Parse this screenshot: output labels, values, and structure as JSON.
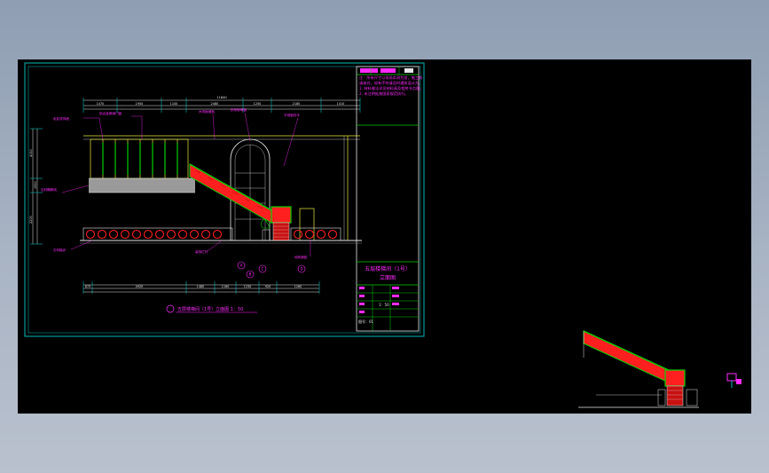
{
  "title_block": {
    "project_title": "五层楼梯间（1号）",
    "sheet_title": "立面图",
    "scale": "1：50",
    "sheet_no": "图号：01"
  },
  "notes": [
    "注：所有尺寸以现场实测为准，施工前",
    "请核对，如有不符请及时通知设计方。",
    "1. 材料做法详见材料表及相关节点图。",
    "2. 未注明处按国家规范执行。"
  ],
  "dimensions": {
    "top_total": "11840",
    "top_segments": [
      "1470",
      "1950",
      "1100",
      "2480",
      "1250",
      "2180",
      "1410"
    ],
    "bottom_total": "11840",
    "bottom_segments": [
      "870",
      "4920",
      "1480",
      "1160",
      "1230",
      "920",
      "1260"
    ],
    "left_heights": [
      "4150",
      "1950",
      "2200"
    ]
  },
  "callouts": [
    "乳胶漆饰面",
    "铝合金玻璃门窗",
    "木饰面墙板",
    "石材踢脚线",
    "拱形玻璃窗",
    "不锈钢扶手",
    "石材踏步",
    "装饰栏杆",
    "地砖铺贴"
  ],
  "detail_labels": [
    "A",
    "B",
    "C",
    "D"
  ],
  "drawing_caption": "五层楼梯间（1号）立面图 1：50",
  "colors": {
    "frame": "#00b8b8",
    "magenta": "#ff2bff",
    "yellow": "#e8e840",
    "green": "#00d000",
    "red": "#ff1f1f",
    "white": "#e6e6e6",
    "gray": "#8c8c8c"
  }
}
